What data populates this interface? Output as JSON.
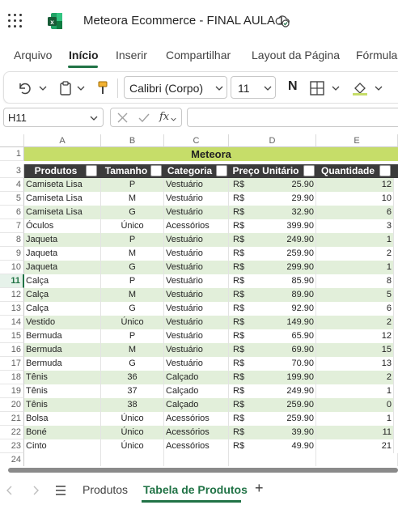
{
  "app": {
    "title": "Meteora Ecommerce - FINAL AULA 1",
    "brand_color": "#217346"
  },
  "ribbon": {
    "tabs": [
      "Arquivo",
      "Início",
      "Inserir",
      "Compartilhar",
      "Layout da Página",
      "Fórmulas"
    ],
    "active_tab": "Início"
  },
  "toolbar": {
    "font_name": "Calibri (Corpo)",
    "font_size": "11",
    "bold_label": "N"
  },
  "formula_bar": {
    "cell_ref": "H11",
    "fx_label": "fx",
    "formula": ""
  },
  "grid": {
    "columns": [
      "A",
      "B",
      "C",
      "D",
      "E"
    ],
    "row_numbers": [
      "1",
      "3",
      "4",
      "5",
      "6",
      "7",
      "8",
      "9",
      "10",
      "11",
      "12",
      "13",
      "14",
      "15",
      "16",
      "17",
      "18",
      "19",
      "20",
      "21",
      "22",
      "23",
      "24"
    ],
    "selected_row": "11",
    "title": "Meteora",
    "headers": [
      "Produtos",
      "Tamanho",
      "Categoria",
      "Preço Unitário",
      "Quantidade"
    ],
    "currency": "R$",
    "rows": [
      [
        "Camiseta Lisa",
        "P",
        "Vestuário",
        "25.90",
        "12"
      ],
      [
        "Camiseta Lisa",
        "M",
        "Vestuário",
        "29.90",
        "10"
      ],
      [
        "Camiseta Lisa",
        "G",
        "Vestuário",
        "32.90",
        "6"
      ],
      [
        "Óculos",
        "Único",
        "Acessórios",
        "399.90",
        "3"
      ],
      [
        "Jaqueta",
        "P",
        "Vestuário",
        "249.90",
        "1"
      ],
      [
        "Jaqueta",
        "M",
        "Vestuário",
        "259.90",
        "2"
      ],
      [
        "Jaqueta",
        "G",
        "Vestuário",
        "299.90",
        "1"
      ],
      [
        "Calça",
        "P",
        "Vestuário",
        "85.90",
        "8"
      ],
      [
        "Calça",
        "M",
        "Vestuário",
        "89.90",
        "5"
      ],
      [
        "Calça",
        "G",
        "Vestuário",
        "92.90",
        "6"
      ],
      [
        "Vestido",
        "Único",
        "Vestuário",
        "149.90",
        "2"
      ],
      [
        "Bermuda",
        "P",
        "Vestuário",
        "65.90",
        "12"
      ],
      [
        "Bermuda",
        "M",
        "Vestuário",
        "69.90",
        "15"
      ],
      [
        "Bermuda",
        "G",
        "Vestuário",
        "70.90",
        "13"
      ],
      [
        "Tênis",
        "36",
        "Calçado",
        "199.90",
        "2"
      ],
      [
        "Tênis",
        "37",
        "Calçado",
        "249.90",
        "1"
      ],
      [
        "Tênis",
        "38",
        "Calçado",
        "259.90",
        "0"
      ],
      [
        "Bolsa",
        "Único",
        "Acessórios",
        "259.90",
        "1"
      ],
      [
        "Boné",
        "Único",
        "Acessórios",
        "39.90",
        "11"
      ],
      [
        "Cinto",
        "Único",
        "Acessórios",
        "49.90",
        "21"
      ]
    ],
    "colors": {
      "title_band": "#c6dd69",
      "header_band": "#3b3b3b",
      "stripe": "#e2efda"
    }
  },
  "sheets": {
    "tabs": [
      "Produtos",
      "Tabela de Produtos"
    ],
    "active": "Tabela de Produtos",
    "add_label": "+"
  }
}
